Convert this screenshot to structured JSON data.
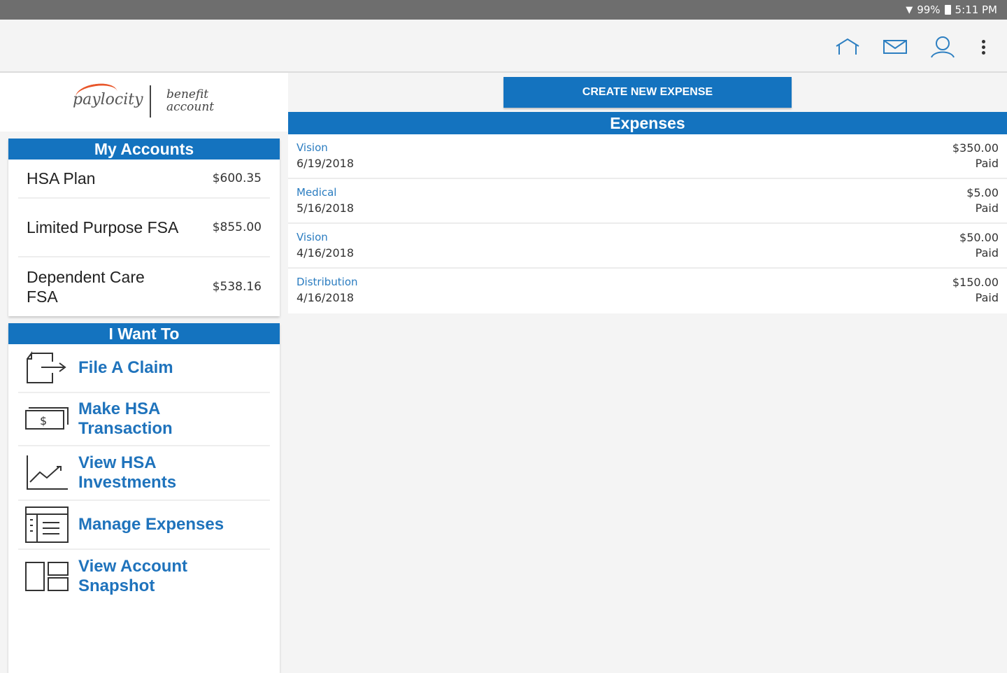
{
  "status_bar": {
    "battery": "99%",
    "time": "5:11 PM"
  },
  "app_bar": {
    "icons": [
      "home-icon",
      "mail-icon",
      "profile-icon",
      "more-vert-icon"
    ]
  },
  "logo": {
    "brand": "paylocity",
    "product_line1": "benefit",
    "product_line2": "account"
  },
  "my_accounts": {
    "title": "My Accounts",
    "items": [
      {
        "name": "HSA Plan",
        "amount": "$600.35"
      },
      {
        "name": "Limited Purpose FSA",
        "amount": "$855.00"
      },
      {
        "name": "Dependent Care FSA",
        "amount": "$538.16"
      }
    ]
  },
  "i_want_to": {
    "title": "I Want To",
    "items": [
      {
        "label": "File A Claim",
        "icon": "file-claim-icon"
      },
      {
        "label": "Make HSA Transaction",
        "icon": "money-icon"
      },
      {
        "label": "View HSA Investments",
        "icon": "chart-icon"
      },
      {
        "label": "Manage Expenses",
        "icon": "list-icon"
      },
      {
        "label": "View Account Snapshot",
        "icon": "snapshot-icon"
      }
    ]
  },
  "expenses": {
    "create_button": "CREATE NEW EXPENSE",
    "title": "Expenses",
    "items": [
      {
        "category": "Vision",
        "date": "6/19/2018",
        "amount": "$350.00",
        "status": "Paid"
      },
      {
        "category": "Medical",
        "date": "5/16/2018",
        "amount": "$5.00",
        "status": "Paid"
      },
      {
        "category": "Vision",
        "date": "4/16/2018",
        "amount": "$50.00",
        "status": "Paid"
      },
      {
        "category": "Distribution",
        "date": "4/16/2018",
        "amount": "$150.00",
        "status": "Paid"
      }
    ]
  },
  "colors": {
    "primary": "#1473bf",
    "link": "#1f73bc"
  }
}
